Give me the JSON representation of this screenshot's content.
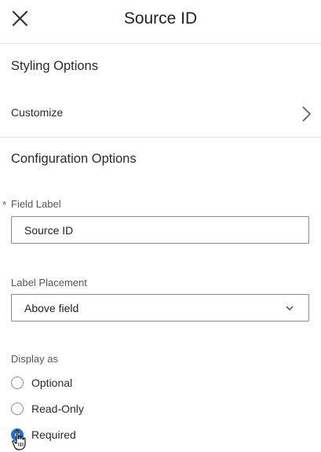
{
  "header": {
    "title": "Source ID"
  },
  "styling": {
    "section_title": "Styling Options",
    "customize_label": "Customize"
  },
  "configuration": {
    "section_title": "Configuration Options",
    "field_label": {
      "label": "Field Label",
      "required_marker": "*",
      "value": "Source ID"
    },
    "label_placement": {
      "label": "Label Placement",
      "selected": "Above field"
    },
    "display_as": {
      "label": "Display as",
      "options": [
        {
          "label": "Optional",
          "checked": false
        },
        {
          "label": "Read-Only",
          "checked": false
        },
        {
          "label": "Required",
          "checked": true
        }
      ]
    }
  },
  "colors": {
    "accent": "#1e6fd9",
    "required": "#d0342c",
    "divider": "#e3e3e3"
  }
}
